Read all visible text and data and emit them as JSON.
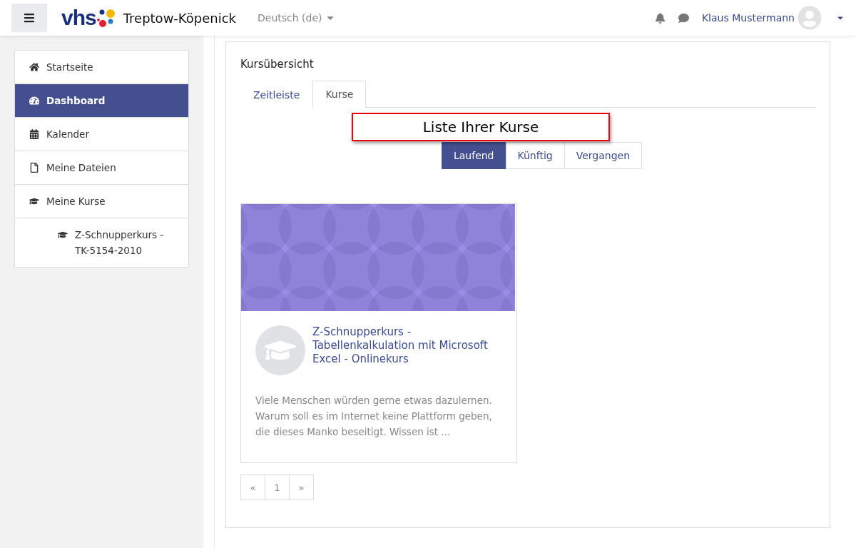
{
  "navbar": {
    "logo_text": "vhs",
    "site_name": "Treptow-Köpenick",
    "language": "Deutsch (de)",
    "user_name": "Klaus Mustermann"
  },
  "sidebar": {
    "items": [
      {
        "label": "Startseite",
        "kind": "home",
        "selected": false
      },
      {
        "label": "Dashboard",
        "kind": "dashboard",
        "selected": true
      },
      {
        "label": "Kalender",
        "kind": "calendar",
        "selected": false
      },
      {
        "label": "Meine Dateien",
        "kind": "file",
        "selected": false
      },
      {
        "label": "Meine Kurse",
        "kind": "course",
        "selected": false,
        "children": [
          {
            "label": "Z-Schnupperkurs - TK-5154-2010",
            "kind": "course",
            "selected": false
          }
        ]
      }
    ]
  },
  "block": {
    "title": "Kursübersicht",
    "tabs": [
      {
        "label": "Zeitleiste",
        "selected": false
      },
      {
        "label": "Kurse",
        "selected": true
      }
    ],
    "callout": "Liste Ihrer Kurse",
    "filters": [
      {
        "label": "Laufend",
        "selected": true
      },
      {
        "label": "Künftig",
        "selected": false
      },
      {
        "label": "Vergangen",
        "selected": false
      }
    ],
    "courses": [
      {
        "title": "Z-Schnupperkurs - Tabellenkalkulation mit Microsoft Excel - Onlinekurs",
        "summary": "Viele Menschen würden gerne etwas dazulernen. Warum soll es im Internet keine Plattform geben, die dieses Manko beseitigt. Wissen ist ..."
      }
    ],
    "pagination": [
      {
        "label": "«",
        "selected": false
      },
      {
        "label": "1",
        "selected": false
      },
      {
        "label": "»",
        "selected": false
      }
    ]
  }
}
